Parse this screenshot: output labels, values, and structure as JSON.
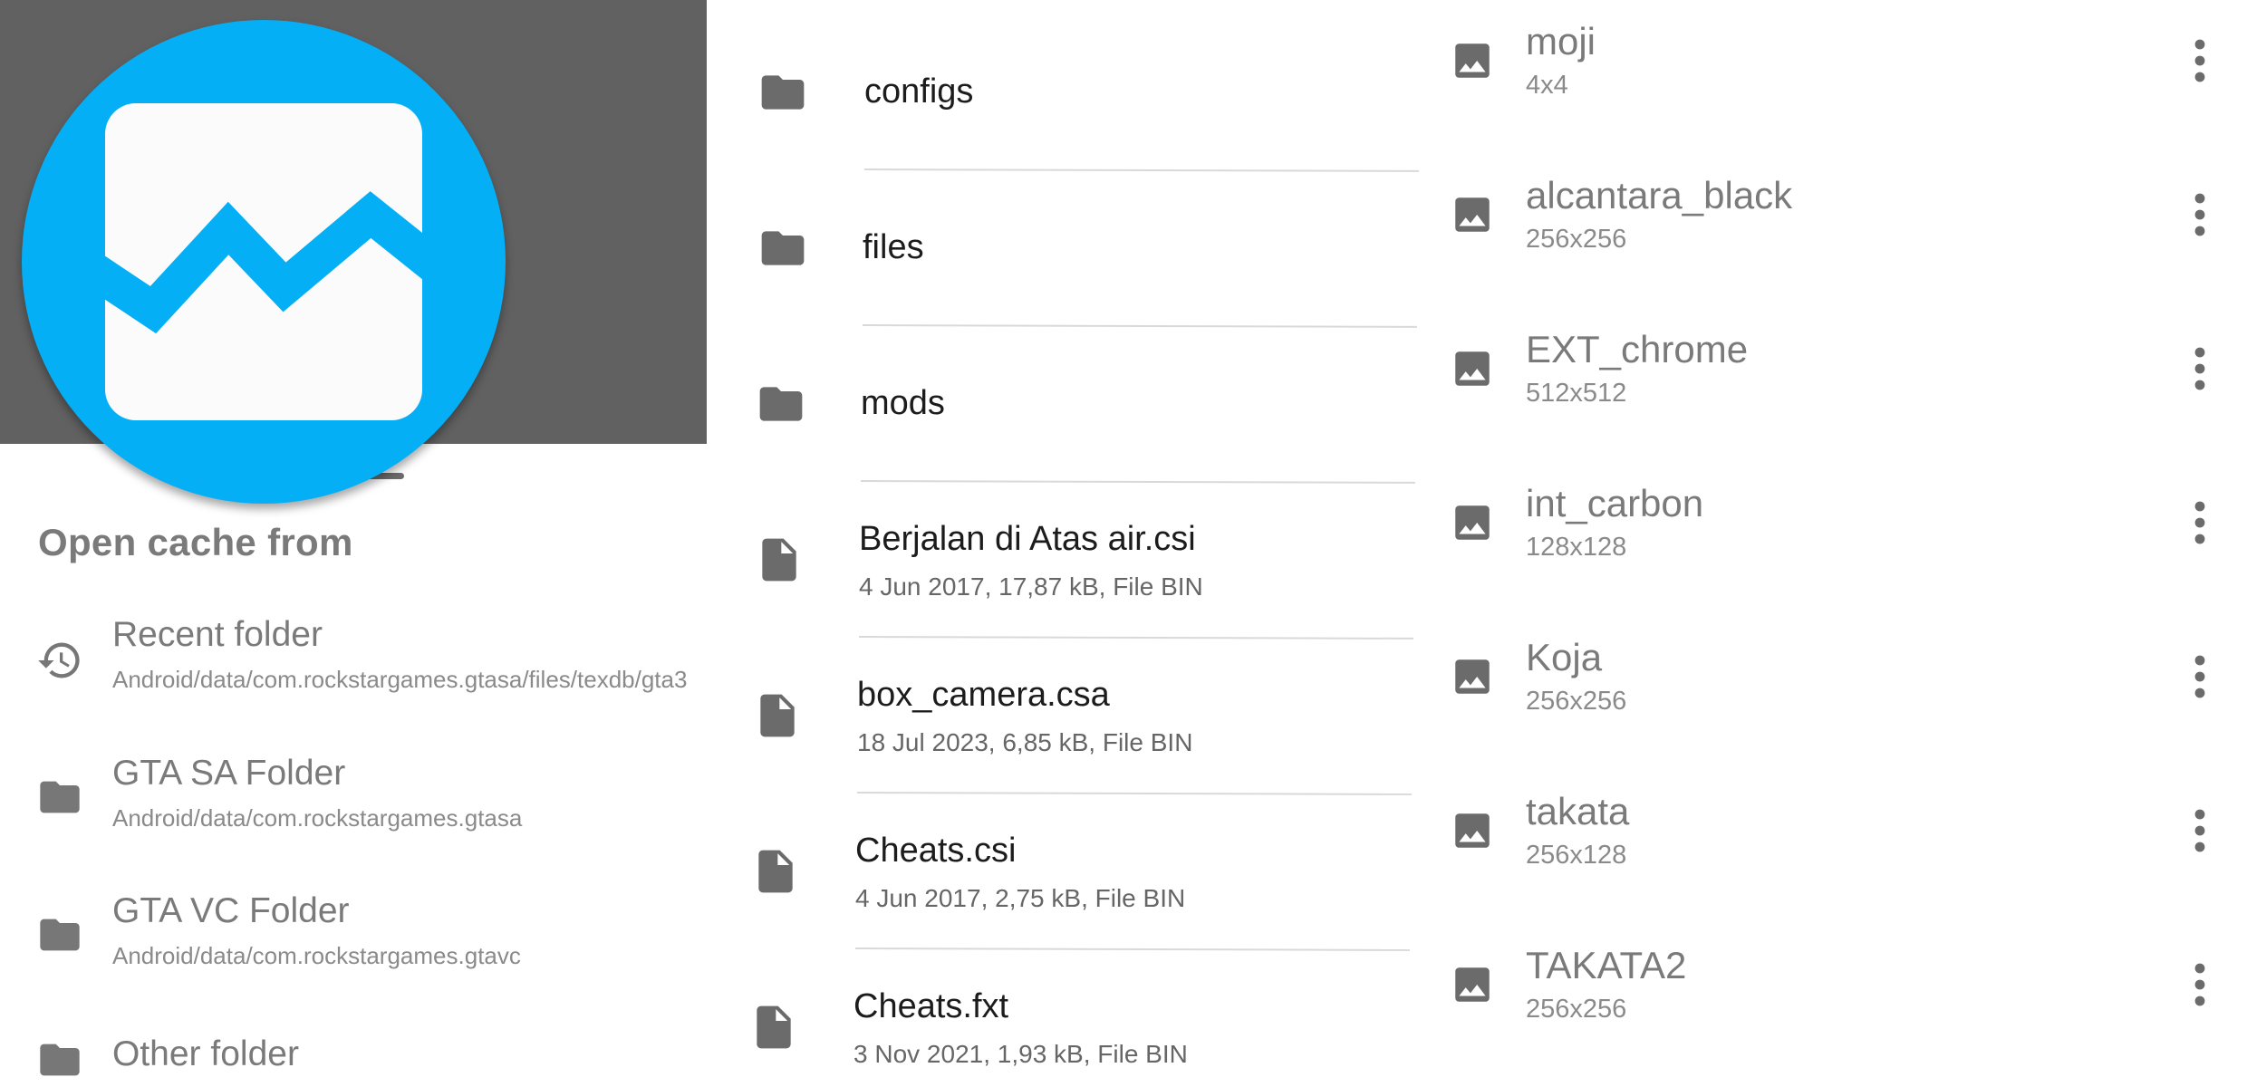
{
  "left": {
    "sheet_title": "Open cache from",
    "options": [
      {
        "icon": "history-icon",
        "label": "Recent folder",
        "path": "Android/data/com.rockstargames.gtasa/files/texdb/gta3"
      },
      {
        "icon": "folder-icon",
        "label": "GTA SA Folder",
        "path": "Android/data/com.rockstargames.gtasa"
      },
      {
        "icon": "folder-icon",
        "label": "GTA VC Folder",
        "path": "Android/data/com.rockstargames.gtavc"
      },
      {
        "icon": "folder-icon",
        "label": "Other folder",
        "path": ""
      }
    ],
    "logo_icon": "txd-tool-logo",
    "colors": {
      "logo": "#05aff6",
      "backdrop": "#616161"
    }
  },
  "middle": {
    "items": [
      {
        "type": "folder",
        "icon": "folder-icon",
        "name": "configs",
        "meta": ""
      },
      {
        "type": "folder",
        "icon": "folder-icon",
        "name": "files",
        "meta": ""
      },
      {
        "type": "folder",
        "icon": "folder-icon",
        "name": "mods",
        "meta": ""
      },
      {
        "type": "file",
        "icon": "file-icon",
        "name": "Berjalan di Atas air.csi",
        "meta": "4 Jun 2017, 17,87 kB, File BIN"
      },
      {
        "type": "file",
        "icon": "file-icon",
        "name": "box_camera.csa",
        "meta": "18 Jul 2023, 6,85 kB, File BIN"
      },
      {
        "type": "file",
        "icon": "file-icon",
        "name": "Cheats.csi",
        "meta": "4 Jun 2017, 2,75 kB, File BIN"
      },
      {
        "type": "file",
        "icon": "file-icon",
        "name": "Cheats.fxt",
        "meta": "3 Nov 2021, 1,93 kB, File BIN"
      }
    ]
  },
  "right": {
    "textures": [
      {
        "icon": "image-icon",
        "name": "moji",
        "size": "4x4"
      },
      {
        "icon": "image-icon",
        "name": "alcantara_black",
        "size": "256x256"
      },
      {
        "icon": "image-icon",
        "name": "EXT_chrome",
        "size": "512x512"
      },
      {
        "icon": "image-icon",
        "name": "int_carbon",
        "size": "128x128"
      },
      {
        "icon": "image-icon",
        "name": "Koja",
        "size": "256x256"
      },
      {
        "icon": "image-icon",
        "name": "takata",
        "size": "256x128"
      },
      {
        "icon": "image-icon",
        "name": "TAKATA2",
        "size": "256x256"
      }
    ],
    "more_icon": "more-vert-icon"
  }
}
